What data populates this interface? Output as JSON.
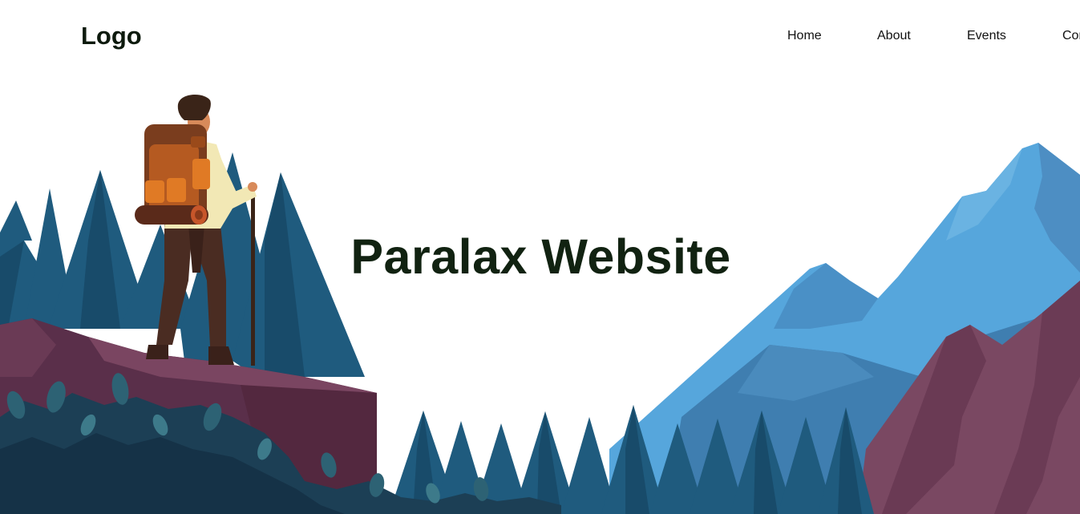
{
  "header": {
    "logo": "Logo",
    "nav": [
      {
        "label": "Home"
      },
      {
        "label": "About"
      },
      {
        "label": "Events"
      },
      {
        "label": "Contact"
      }
    ]
  },
  "hero": {
    "title": "Paralax Website"
  },
  "colors": {
    "title_text": "#112211",
    "mountain_blue_light": "#56a6dc",
    "mountain_blue_dark": "#3f7eb0",
    "mountain_purple": "#7a4862",
    "rock_purple": "#5a2f4a",
    "tree_blue": "#1f5b7e",
    "foliage_dark": "#153247",
    "backpack_orange": "#b55a21",
    "shirt_cream": "#f2e8b5",
    "pants_brown": "#4a2c22"
  },
  "illustration": {
    "icons": [
      "hiker-figure",
      "backpack",
      "walking-stick",
      "pine-trees",
      "mountains",
      "rock-cliff",
      "foliage"
    ]
  }
}
